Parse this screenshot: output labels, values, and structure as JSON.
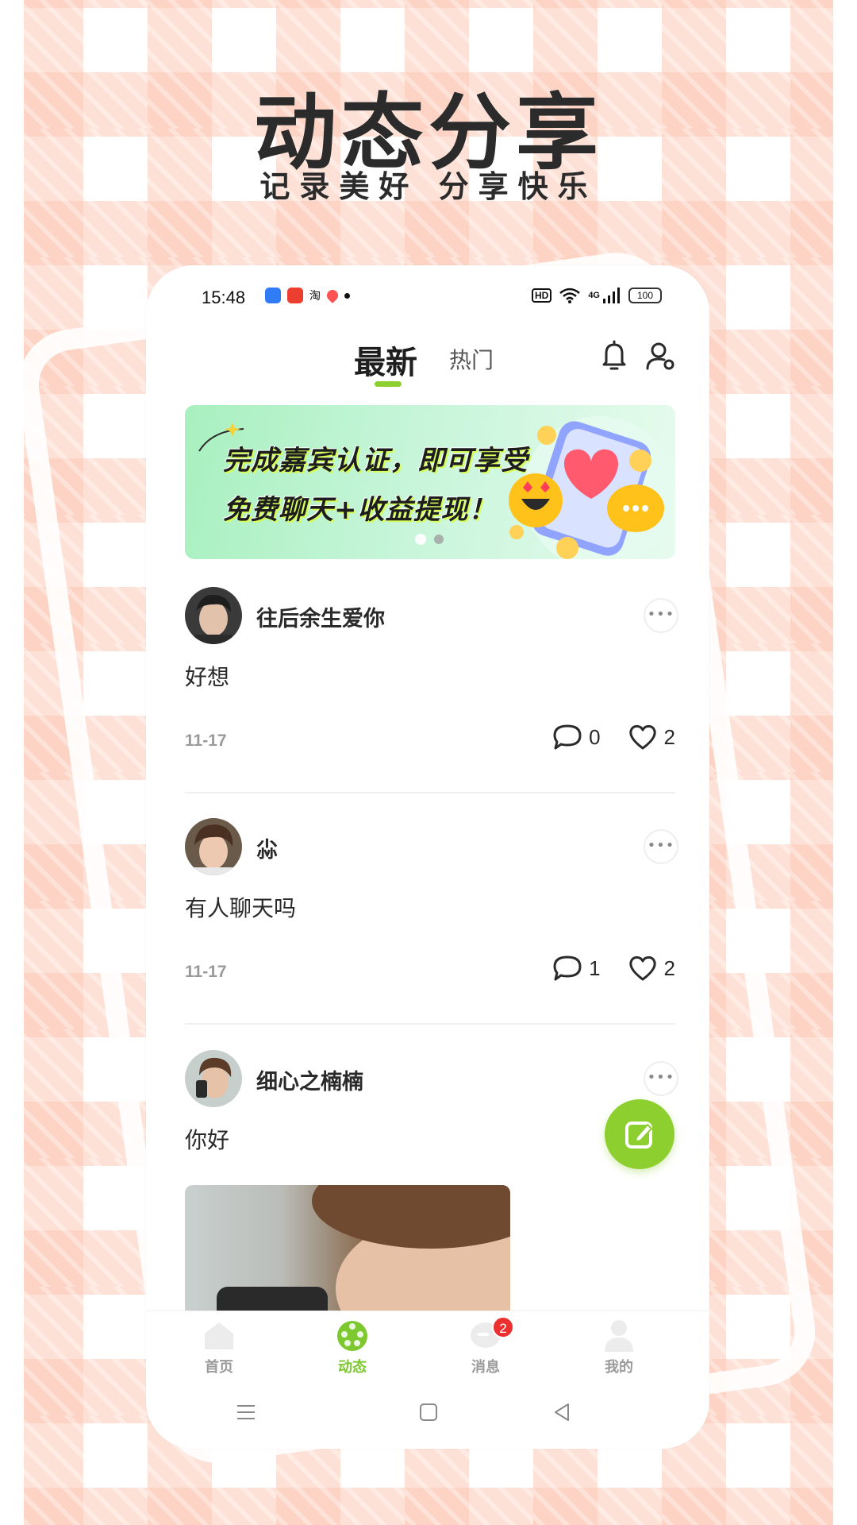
{
  "promo": {
    "title": "动态分享",
    "subtitle": "记录美好  分享快乐"
  },
  "status_bar": {
    "time": "15:48",
    "app_text": "淘",
    "hd": "HD",
    "network": "4G",
    "battery": "100"
  },
  "tabs": {
    "latest": "最新",
    "hot": "热门"
  },
  "banner": {
    "line1": "完成嘉宾认证，即可享受",
    "line2": "免费聊天+收益提现！",
    "active_slide": 1,
    "slide_count": 2
  },
  "posts": [
    {
      "name": "往后余生爱你",
      "content": "好想",
      "date": "11-17",
      "comments": "0",
      "likes": "2"
    },
    {
      "name": "尛",
      "content": "有人聊天吗",
      "date": "11-17",
      "comments": "1",
      "likes": "2"
    },
    {
      "name": "细心之楠楠",
      "content": "你好"
    }
  ],
  "more_dots": "•••",
  "tabbar": {
    "items": [
      {
        "label": "首页",
        "icon": "home-icon"
      },
      {
        "label": "动态",
        "icon": "moments-icon"
      },
      {
        "label": "消息",
        "icon": "message-icon",
        "badge": "2"
      },
      {
        "label": "我的",
        "icon": "profile-icon"
      }
    ],
    "active_index": 1
  },
  "colors": {
    "accent": "#8ccf2f",
    "badge": "#ec3030",
    "background_check": "#fcc8b4"
  }
}
